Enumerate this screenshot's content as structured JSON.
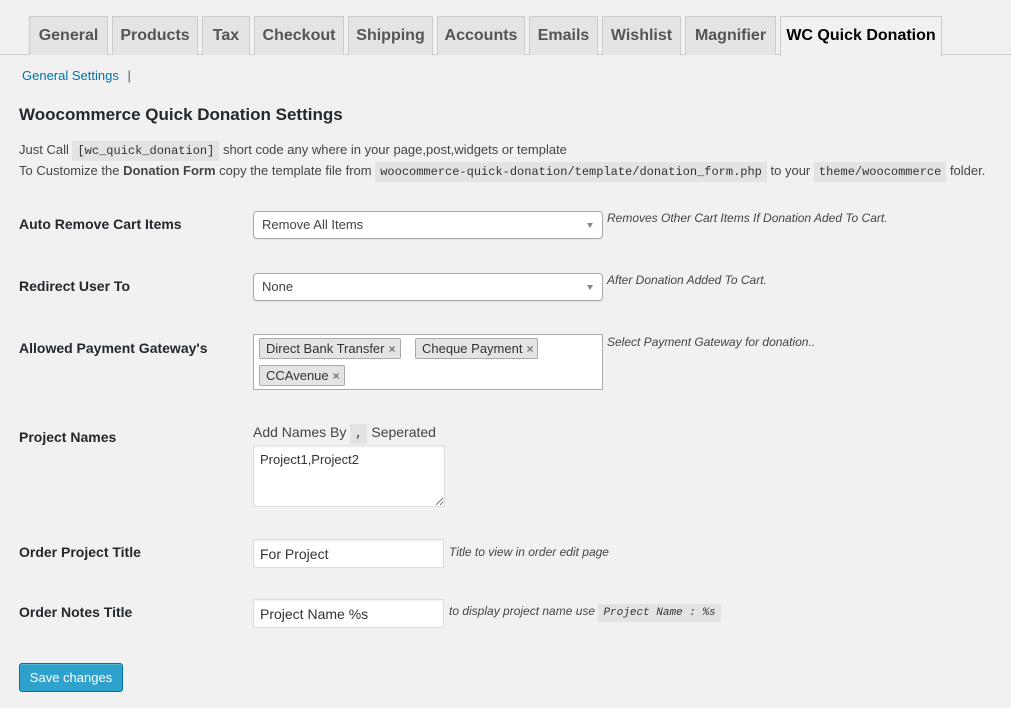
{
  "tabs": [
    "General",
    "Products",
    "Tax",
    "Checkout",
    "Shipping",
    "Accounts",
    "Emails",
    "Wishlist",
    "Magnifier",
    "WC Quick Donation"
  ],
  "active_tab": "WC Quick Donation",
  "subsubsub": {
    "link": "General Settings",
    "separator": "|"
  },
  "title": "Woocommerce Quick Donation Settings",
  "desc": {
    "l1_a": "Just Call",
    "l1_code": "[wc_quick_donation]",
    "l1_b": "short code any where in your page,post,widgets or template",
    "l2_a": "To Customize the",
    "l2_bold": "Donation Form",
    "l2_b": "copy the template file from",
    "l2_code1": "woocommerce-quick-donation/template/donation_form.php",
    "l2_c": "to your",
    "l2_code2": "theme/woocommerce",
    "l2_d": "folder."
  },
  "fields": {
    "auto_remove": {
      "label": "Auto Remove Cart Items",
      "value": "Remove All Items",
      "help": "Removes Other Cart Items If Donation Aded To Cart."
    },
    "redirect": {
      "label": "Redirect User To",
      "value": "None",
      "help": "After Donation Added To Cart."
    },
    "gateways": {
      "label": "Allowed Payment Gateway's",
      "chips": [
        "Direct Bank Transfer",
        "Cheque Payment",
        "CCAvenue"
      ],
      "help": "Select Payment Gateway for donation.."
    },
    "projects": {
      "label": "Project Names",
      "hint_a": "Add Names By",
      "hint_code": ",",
      "hint_b": "Seperated",
      "value": "Project1,Project2"
    },
    "order_title": {
      "label": "Order Project Title",
      "value": "For Project",
      "help": "Title to view in order edit page"
    },
    "notes_title": {
      "label": "Order Notes Title",
      "value": "Project Name %s",
      "help": "to display project name use",
      "help_code": "Project Name : %s"
    }
  },
  "save_label": "Save changes"
}
